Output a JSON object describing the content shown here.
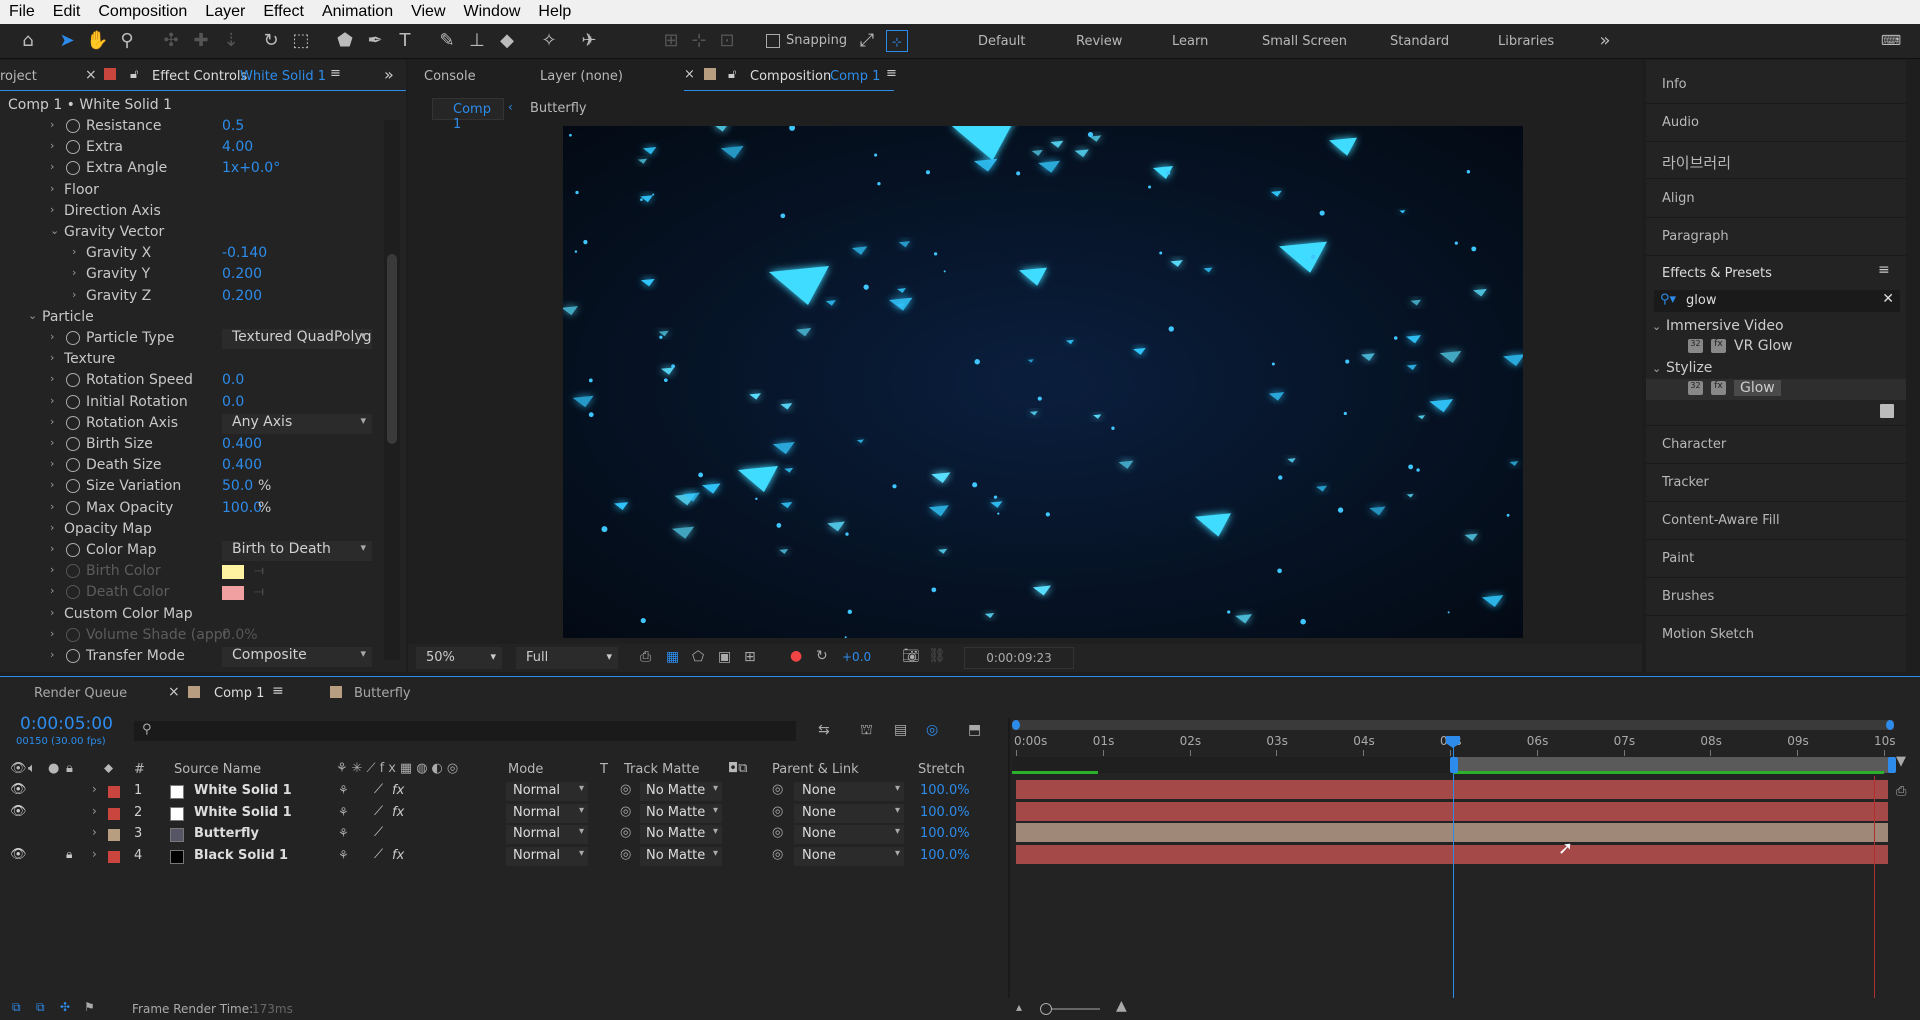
{
  "menu": [
    "File",
    "Edit",
    "Composition",
    "Layer",
    "Effect",
    "Animation",
    "View",
    "Window",
    "Help"
  ],
  "toolbar": {
    "snapping_label": "Snapping",
    "workspaces": [
      "Default",
      "Review",
      "Learn",
      "Small Screen",
      "Standard",
      "Libraries"
    ]
  },
  "effect_controls": {
    "project_tab": "roject",
    "tab_label": "Effect Controls",
    "tab_layer": "White Solid 1",
    "breadcrumb": "Comp 1 • White Solid 1",
    "rows": [
      {
        "label": "Resistance",
        "value": "0.5"
      },
      {
        "label": "Extra",
        "value": "4.00"
      },
      {
        "label": "Extra Angle",
        "value": "1x+0.0°"
      },
      {
        "label": "Floor",
        "value": ""
      },
      {
        "label": "Direction Axis",
        "value": ""
      },
      {
        "label": "Gravity Vector",
        "value": ""
      },
      {
        "label": "Gravity X",
        "value": "-0.140"
      },
      {
        "label": "Gravity Y",
        "value": "0.200"
      },
      {
        "label": "Gravity Z",
        "value": "0.200"
      },
      {
        "label": "Particle",
        "value": ""
      },
      {
        "label": "Particle Type",
        "value": "Textured QuadPolyg"
      },
      {
        "label": "Texture",
        "value": ""
      },
      {
        "label": "Rotation Speed",
        "value": "0.0"
      },
      {
        "label": "Initial Rotation",
        "value": "0.0"
      },
      {
        "label": "Rotation Axis",
        "value": "Any Axis"
      },
      {
        "label": "Birth Size",
        "value": "0.400"
      },
      {
        "label": "Death Size",
        "value": "0.400"
      },
      {
        "label": "Size Variation",
        "value": "50.0",
        "unit": "%"
      },
      {
        "label": "Max Opacity",
        "value": "100.0",
        "unit": "%"
      },
      {
        "label": "Opacity Map",
        "value": ""
      },
      {
        "label": "Color Map",
        "value": "Birth to Death"
      },
      {
        "label": "Birth Color",
        "value": ""
      },
      {
        "label": "Death Color",
        "value": ""
      },
      {
        "label": "Custom Color Map",
        "value": ""
      },
      {
        "label": "Volume Shade (appr",
        "value": "0.0%"
      },
      {
        "label": "Transfer Mode",
        "value": "Composite"
      }
    ],
    "colors": {
      "birth": "#fff2a0",
      "death": "#f0a0a0"
    }
  },
  "viewer": {
    "tabs": [
      "Console",
      "Layer (none)"
    ],
    "comp_tab": "Composition",
    "comp_name": "Comp 1",
    "subtabs": [
      "Comp 1",
      "Butterfly"
    ],
    "zoom": "50%",
    "resolution": "Full",
    "exposure": "+0.0",
    "timecode": "0:00:09:23"
  },
  "right_panel": {
    "items_top": [
      "Info",
      "Audio",
      "라이브러리",
      "Align",
      "Paragraph"
    ],
    "effects_presets": "Effects & Presets",
    "search_value": "glow",
    "tree": [
      {
        "group": "Immersive Video",
        "item": "VR Glow"
      },
      {
        "group": "Stylize",
        "item": "Glow"
      }
    ],
    "items_bottom": [
      "Character",
      "Tracker",
      "Content-Aware Fill",
      "Paint",
      "Brushes",
      "Motion Sketch"
    ]
  },
  "timeline": {
    "tabs": [
      "Render Queue",
      "Comp 1",
      "Butterfly"
    ],
    "timecode": "0:00:05:00",
    "frame_info": "00150 (30.00 fps)",
    "columns": [
      "#",
      "Source Name",
      "Mode",
      "T",
      "Track Matte",
      "Parent & Link",
      "Stretch"
    ],
    "layers": [
      {
        "num": "1",
        "name": "White Solid 1",
        "mode": "Normal",
        "matte": "No Matte",
        "parent": "None",
        "stretch": "100.0%",
        "label": "#c9453e",
        "swatch": "#ffffff",
        "fx": true
      },
      {
        "num": "2",
        "name": "White Solid 1",
        "mode": "Normal",
        "matte": "No Matte",
        "parent": "None",
        "stretch": "100.0%",
        "label": "#c9453e",
        "swatch": "#ffffff",
        "fx": true
      },
      {
        "num": "3",
        "name": "Butterfly",
        "mode": "Normal",
        "matte": "No Matte",
        "parent": "None",
        "stretch": "100.0%",
        "label": "#b79e80",
        "swatch": "#556",
        "fx": false
      },
      {
        "num": "4",
        "name": "Black Solid 1",
        "mode": "Normal",
        "matte": "No Matte",
        "parent": "None",
        "stretch": "100.0%",
        "label": "#c9453e",
        "swatch": "#000000",
        "fx": true
      }
    ],
    "ruler": [
      "0:00s",
      "01s",
      "02s",
      "03s",
      "04s",
      "05s",
      "06s",
      "07s",
      "08s",
      "09s",
      "10s"
    ],
    "playhead_seconds": 5,
    "bar_colors": [
      "#a54848",
      "#a54848",
      "#a08878",
      "#a54848"
    ],
    "footer_label": "Frame Render Time:",
    "footer_value": "173ms"
  }
}
